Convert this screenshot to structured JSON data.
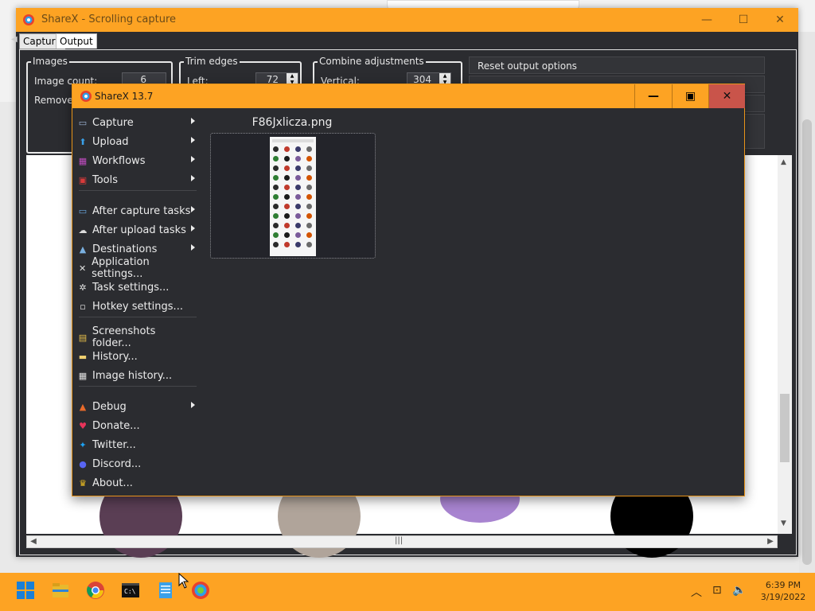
{
  "scroll_capture": {
    "title": "ShareX - Scrolling capture",
    "tabs": {
      "capture": "Capture",
      "output": "Output"
    },
    "images_group": {
      "label": "Images",
      "image_count_label": "Image count:",
      "image_count": "6",
      "remove_label": "Remove la"
    },
    "trim_group": {
      "label": "Trim edges",
      "left_label": "Left:",
      "left_value": "72"
    },
    "combine_group": {
      "label": "Combine adjustments",
      "vertical_label": "Vertical:",
      "vertical_value": "304"
    },
    "reset_button": "Reset output options"
  },
  "main_window": {
    "title": "ShareX 13.7",
    "menu": [
      {
        "label": "Capture",
        "submenu": true,
        "icon": "capture-icon"
      },
      {
        "label": "Upload",
        "submenu": true,
        "icon": "upload-icon"
      },
      {
        "label": "Workflows",
        "submenu": true,
        "icon": "workflows-icon"
      },
      {
        "label": "Tools",
        "submenu": true,
        "icon": "tools-icon"
      },
      {
        "label": "After capture tasks",
        "submenu": true,
        "icon": "after-capture-icon"
      },
      {
        "label": "After upload tasks",
        "submenu": true,
        "icon": "after-upload-icon"
      },
      {
        "label": "Destinations",
        "submenu": true,
        "icon": "destinations-icon"
      },
      {
        "label": "Application settings...",
        "submenu": false,
        "icon": "application-settings-icon"
      },
      {
        "label": "Task settings...",
        "submenu": false,
        "icon": "gear-icon"
      },
      {
        "label": "Hotkey settings...",
        "submenu": false,
        "icon": "keyboard-icon"
      },
      {
        "label": "Screenshots folder...",
        "submenu": false,
        "icon": "folder-icon"
      },
      {
        "label": "History...",
        "submenu": false,
        "icon": "history-icon"
      },
      {
        "label": "Image history...",
        "submenu": false,
        "icon": "image-history-icon"
      },
      {
        "label": "Debug",
        "submenu": true,
        "icon": "debug-icon"
      },
      {
        "label": "Donate...",
        "submenu": false,
        "icon": "heart-icon"
      },
      {
        "label": "Twitter...",
        "submenu": false,
        "icon": "twitter-icon"
      },
      {
        "label": "Discord...",
        "submenu": false,
        "icon": "discord-icon"
      },
      {
        "label": "About...",
        "submenu": false,
        "icon": "crown-icon"
      }
    ],
    "thumbnail_filename": "F86Jxlicza.png"
  },
  "taskbar": {
    "time": "6:39 PM",
    "date": "3/19/2022",
    "apps": [
      "start-icon",
      "file-explorer-icon",
      "chrome-icon",
      "terminal-icon",
      "notepad-icon",
      "sharex-icon"
    ]
  },
  "colors": {
    "accent": "#fda323",
    "window_bg": "#2b2c30",
    "close_hover": "#c9544a"
  }
}
